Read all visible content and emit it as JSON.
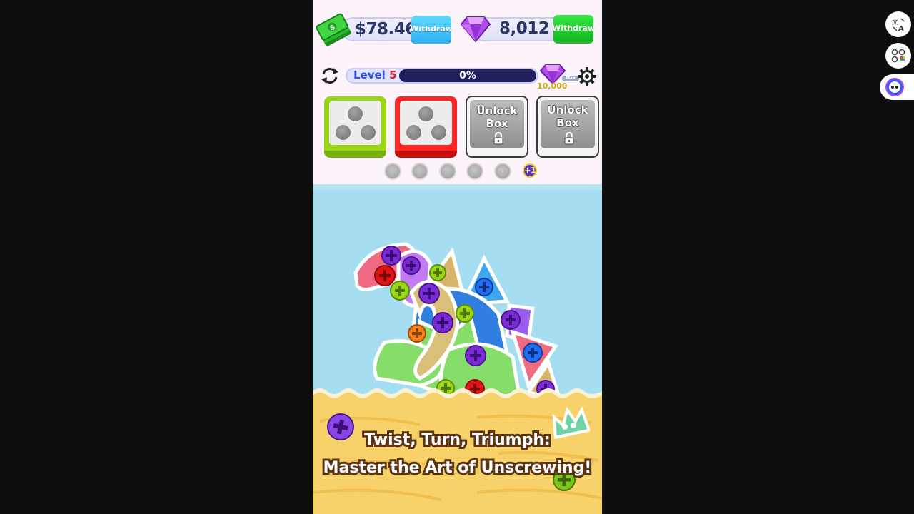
{
  "hud": {
    "cash": {
      "icon": "cash-stack-icon",
      "value": "$78.46",
      "button_label": "Withdraw"
    },
    "gems": {
      "icon": "purple-gem-icon",
      "value": "8,012",
      "button_label": "Withdraw"
    }
  },
  "level": {
    "label": "Level",
    "number": "5",
    "progress_text": "0%",
    "progress": 0,
    "reward_icon": "gem-reward-icon",
    "reward_amount": "10,000",
    "reward_tag": "Max"
  },
  "boxes": [
    {
      "color": "#9bd616",
      "state": "open",
      "holes": 3
    },
    {
      "color": "#ff2525",
      "state": "open",
      "holes": 3
    },
    {
      "state": "locked",
      "label_line1": "Unlock",
      "label_line2": "Box"
    },
    {
      "state": "locked",
      "label_line1": "Unlock",
      "label_line2": "Box"
    }
  ],
  "slots": {
    "empty_count": 5,
    "add_label": "+1"
  },
  "tagline": {
    "line1": "Twist, Turn, Triumph:",
    "line2": "Master the Art of Unscrewing!"
  },
  "side_buttons": [
    {
      "icon": "translate-icon"
    },
    {
      "icon": "apps-grid-icon"
    },
    {
      "icon": "assistant-face-icon"
    }
  ],
  "colors": {
    "sky": "#a5def0",
    "sand": "#f7d26a",
    "screw_purple": "#7b2bd6",
    "screw_red": "#e01414",
    "screw_lime": "#9bd616",
    "screw_blue": "#1f6df2"
  }
}
